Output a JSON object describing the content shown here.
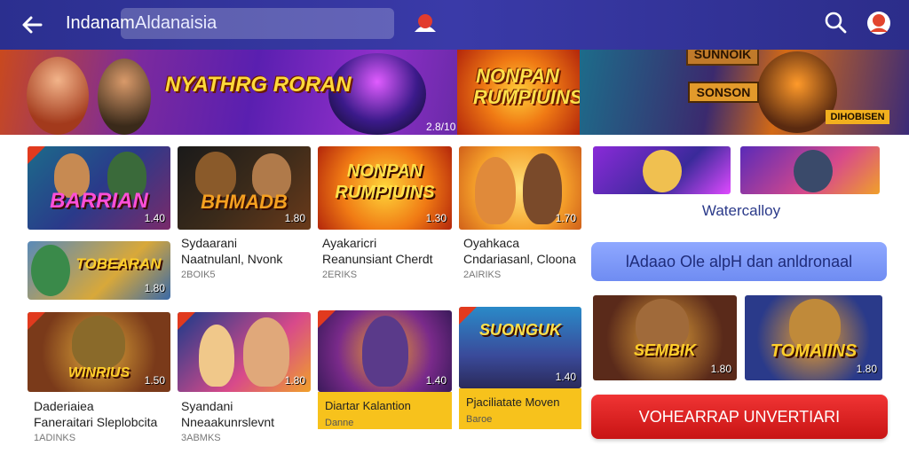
{
  "header": {
    "title": "Indanam",
    "search_value": "Aldanaisia",
    "icons": {
      "back": "back-arrow-icon",
      "mid": "notification-icon",
      "search": "search-icon",
      "avatar": "avatar-icon"
    }
  },
  "banner": {
    "slide1_title": "NYATHRG RORAN",
    "slide1_badge": "2.8/10",
    "slide2_title": "NONPAN RUMPIUINS",
    "slide3_tag1": "SUNNOIK",
    "slide3_tag2": "SONSON",
    "slide3_tag3": "DIHOBISEN"
  },
  "games": [
    {
      "title": "BARRIAN",
      "badge": "1.40",
      "l1": "",
      "l2": "",
      "l3": ""
    },
    {
      "title": "BHMADB",
      "badge": "1.80",
      "l1": "",
      "l2": "",
      "l3": ""
    },
    {
      "title": "NONPAN RUMPIUINS",
      "badge": "1.30",
      "l1": "",
      "l2": "",
      "l3": ""
    },
    {
      "title": "",
      "badge": "1.70",
      "l1": "",
      "l2": "",
      "l3": ""
    },
    {
      "title": "TOBEARAN",
      "badge": "1.80",
      "l1": "Sydaarani",
      "l2": "Naatnulanl, Nvonk",
      "l3": "2BOIK5"
    },
    {
      "title": "",
      "badge": "",
      "l1": "Ayakaricri",
      "l2": "Reanunsiant Cherdt",
      "l3": "2ERIKS"
    },
    {
      "title": "",
      "badge": "",
      "l1": "Oyahkaca",
      "l2": "Cndariasanl, Cloona",
      "l3": "2AIRIKS"
    },
    {
      "title": "WINRIUS",
      "badge": "1.50",
      "l1": "Daderiaiea",
      "l2": "Faneraitari Sleplobcita",
      "l3": "1ADINKS"
    },
    {
      "title": "",
      "badge": "1.80",
      "l1": "Syandani",
      "l2": "Nneaakunrslevnt",
      "l3": "3ABMKS"
    },
    {
      "title": "",
      "badge": "1.40",
      "l1": "Diartar Kalantion",
      "l2": "",
      "l3": "Danne"
    },
    {
      "title": "SUONGUK",
      "badge": "1.40",
      "l1": "Pjaciliatate Moven",
      "l2": "",
      "l3": "Baroe"
    }
  ],
  "right": {
    "subtitle": "Watercalloy",
    "blue_button": "lAdaao Ole alpH dan anldronaal",
    "red_button": "VOHEARRAP UNVERTIARI",
    "promo1_title": "SEMBIK",
    "promo1_badge": "1.80",
    "promo2_title": "TOMAIINS",
    "promo2_badge": "1.80"
  }
}
